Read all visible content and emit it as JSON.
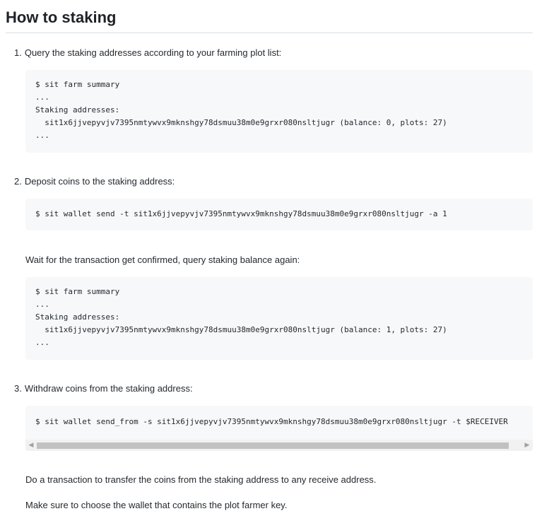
{
  "heading": "How to staking",
  "steps": [
    {
      "num": "1.",
      "text": "Query the staking addresses according to your farming plot list:",
      "code": [
        "$ sit farm summary",
        "...",
        "Staking addresses:",
        "  sit1x6jjvepyvjv7395nmtywvx9mknshgy78dsmuu38m0e9grxr080nsltjugr (balance: 0, plots: 27)",
        "..."
      ]
    },
    {
      "num": "2.",
      "text": "Deposit coins to the staking address:",
      "code": [
        "$ sit wallet send -t sit1x6jjvepyvjv7395nmtywvx9mknshgy78dsmuu38m0e9grxr080nsltjugr -a 1"
      ],
      "followup": "Wait for the transaction get confirmed, query staking balance again:",
      "code2": [
        "$ sit farm summary",
        "...",
        "Staking addresses:",
        "  sit1x6jjvepyvjv7395nmtywvx9mknshgy78dsmuu38m0e9grxr080nsltjugr (balance: 1, plots: 27)",
        "..."
      ]
    },
    {
      "num": "3.",
      "text": "Withdraw coins from the staking address:",
      "code": [
        "$ sit wallet send_from -s sit1x6jjvepyvjv7395nmtywvx9mknshgy78dsmuu38m0e9grxr080nsltjugr -t $RECEIVER"
      ],
      "notes": [
        "Do a transaction to transfer the coins from the staking address to any receive address.",
        "Make sure to choose the wallet that contains the plot farmer key."
      ]
    }
  ],
  "scrollbar": {
    "left_arrow": "◀",
    "right_arrow": "▶"
  }
}
